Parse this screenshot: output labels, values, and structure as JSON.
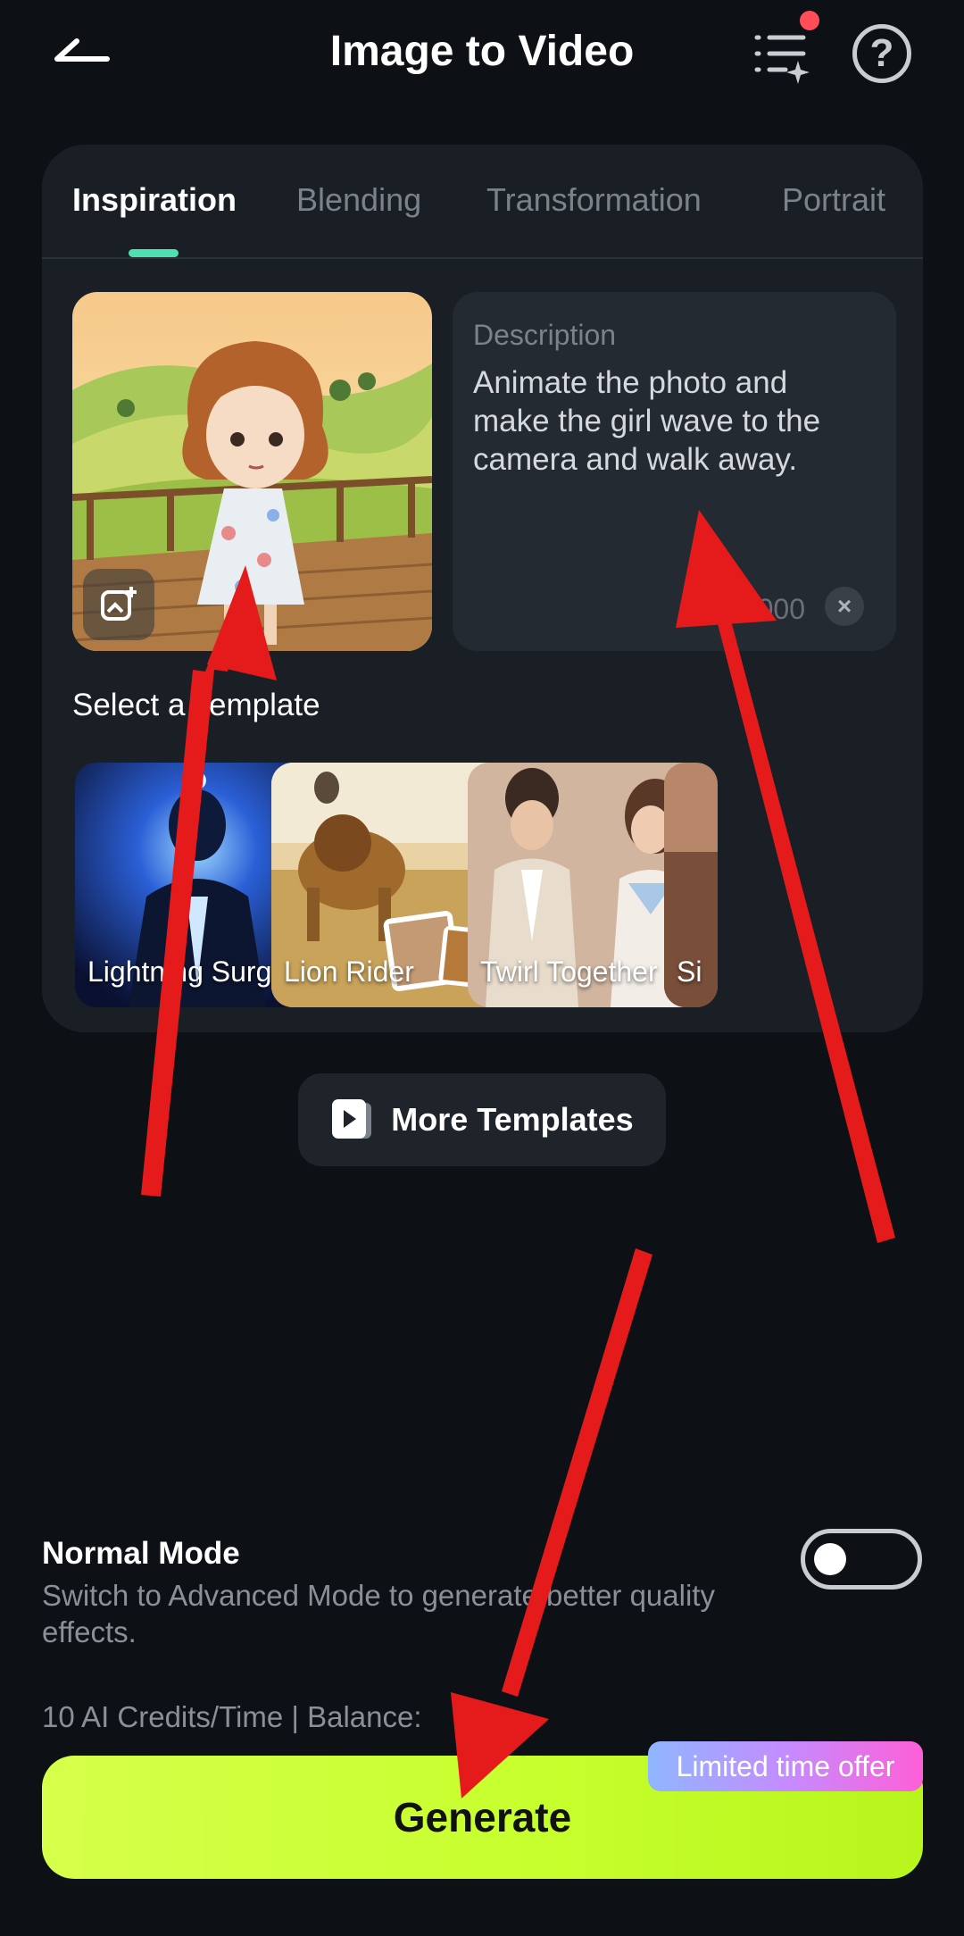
{
  "header": {
    "title": "Image to Video"
  },
  "tabs": [
    {
      "label": "Inspiration"
    },
    {
      "label": "Blending"
    },
    {
      "label": "Transformation"
    },
    {
      "label": "Portrait"
    }
  ],
  "description": {
    "label": "Description",
    "text": "Animate the photo and make the girl wave to the camera and walk away.",
    "char_count": "1000"
  },
  "templates": {
    "section_title": "Select a Template",
    "items": [
      {
        "label": "Lightning Surge"
      },
      {
        "label": "Lion Rider"
      },
      {
        "label": "Twirl Together"
      },
      {
        "label": "Si"
      }
    ]
  },
  "more_templates": {
    "label": "More Templates"
  },
  "mode": {
    "title": "Normal Mode",
    "description": "Switch to Advanced Mode to generate better quality effects.",
    "advanced_enabled": false
  },
  "credits": {
    "text": "10 AI Credits/Time | Balance:"
  },
  "generate": {
    "label": "Generate",
    "offer_badge": "Limited time offer"
  },
  "colors": {
    "background": "#0d1116",
    "card": "#1a1f26",
    "accent_tab": "#4de0b0",
    "generate": "#c7ff2e",
    "annotation_arrow": "#e51b1b"
  }
}
